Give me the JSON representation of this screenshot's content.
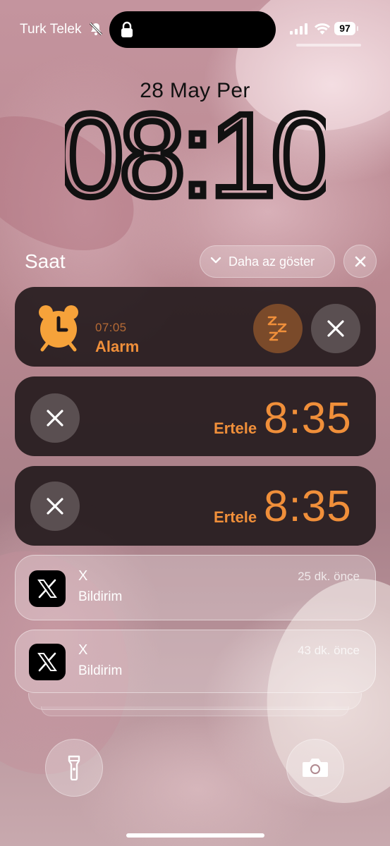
{
  "status_bar": {
    "carrier": "Turk Telek",
    "battery": "97",
    "icons": [
      "bell-slash-icon",
      "lock-icon",
      "signal-icon",
      "wifi-icon",
      "battery-icon"
    ]
  },
  "lock_screen": {
    "date": "28 May Per",
    "time": "08:10"
  },
  "group": {
    "title": "Saat",
    "show_less_label": "Daha az göster"
  },
  "alarm": {
    "time": "07:05",
    "label": "Alarm"
  },
  "snoozes": [
    {
      "label": "Ertele",
      "time": "8:35"
    },
    {
      "label": "Ertele",
      "time": "8:35"
    }
  ],
  "notifications": [
    {
      "app": "X",
      "body": "Bildirim",
      "time": "25 dk. önce"
    },
    {
      "app": "X",
      "body": "Bildirim",
      "time": "43 dk. önce"
    }
  ],
  "colors": {
    "accent_orange": "#f08f3a",
    "snooze_button": "#7a4a2a",
    "card_dark": "#1e1618"
  },
  "bottom_icons": [
    "flashlight-icon",
    "camera-icon"
  ]
}
